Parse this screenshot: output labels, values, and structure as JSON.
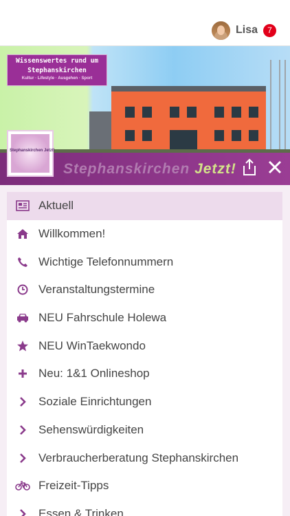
{
  "header": {
    "user_name": "Lisa",
    "notification_count": "7"
  },
  "banner": {
    "info_title_line1": "Wissenswertes rund um",
    "info_title_line2": "Stephanskirchen",
    "info_subtitle": "Kultur · Lifestyle · Ausgehen · Sport",
    "logo_text": "Stephanskirchen Jetzt!",
    "script_text_main": "Stephanskirchen",
    "script_text_accent": "Jetzt!"
  },
  "menu": {
    "items": [
      {
        "label": "Aktuell",
        "icon": "newspaper-icon"
      },
      {
        "label": "Willkommen!",
        "icon": "home-icon"
      },
      {
        "label": "Wichtige Telefonnummern",
        "icon": "phone-icon"
      },
      {
        "label": "Veranstaltungstermine",
        "icon": "clock-icon"
      },
      {
        "label": "NEU Fahrschule Holewa",
        "icon": "car-icon"
      },
      {
        "label": "NEU WinTaekwondo",
        "icon": "star-icon"
      },
      {
        "label": "Neu: 1&1 Onlineshop",
        "icon": "plus-icon"
      },
      {
        "label": "Soziale Einrichtungen",
        "icon": "chevron-right-icon"
      },
      {
        "label": "Sehenswürdigkeiten",
        "icon": "chevron-right-icon"
      },
      {
        "label": "Verbraucherberatung Stephanskirchen",
        "icon": "chevron-right-icon"
      },
      {
        "label": "Freizeit-Tipps",
        "icon": "bicycle-icon"
      },
      {
        "label": "Essen & Trinken",
        "icon": "chevron-right-icon"
      }
    ]
  },
  "colors": {
    "accent": "#8a3a8b",
    "active_bg": "#eddbec",
    "badge": "#e2001a"
  }
}
